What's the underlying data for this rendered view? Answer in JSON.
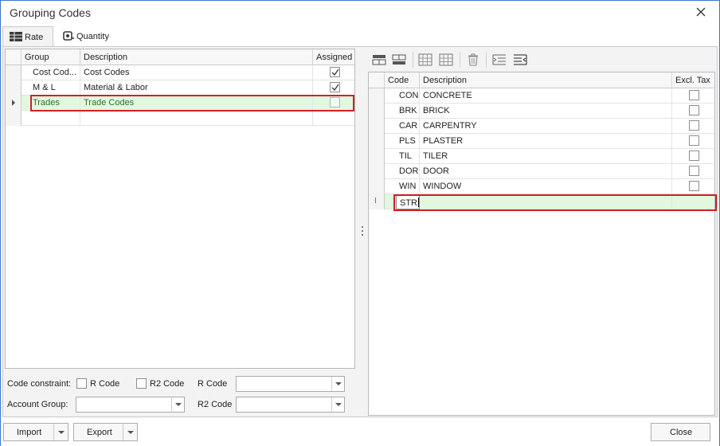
{
  "window": {
    "title": "Grouping Codes"
  },
  "tabs": [
    {
      "label": "Rate",
      "icon": "table-icon",
      "active": true
    },
    {
      "label": "Quantity",
      "icon": "tape-measure-icon",
      "active": false
    }
  ],
  "left_grid": {
    "headers": [
      "Group",
      "Description",
      "Assigned"
    ],
    "rows": [
      {
        "group": "Cost Cod...",
        "description": "Cost Codes",
        "assigned": true
      },
      {
        "group": "M & L",
        "description": "Material & Labor",
        "assigned": true
      },
      {
        "group": "Trades",
        "description": "Trade Codes",
        "assigned": false,
        "selected": true
      }
    ]
  },
  "toolbar": {
    "icons": [
      "insert-row-above-icon",
      "insert-row-below-icon",
      "grid-icon",
      "grid-alt-icon",
      "delete-icon",
      "outdent-icon",
      "indent-icon"
    ]
  },
  "right_grid": {
    "headers": [
      "Code",
      "Description",
      "Excl. Tax"
    ],
    "rows": [
      {
        "code": "CON",
        "description": "CONCRETE",
        "excl_tax": false
      },
      {
        "code": "BRK",
        "description": "BRICK",
        "excl_tax": false
      },
      {
        "code": "CAR",
        "description": "CARPENTRY",
        "excl_tax": false
      },
      {
        "code": "PLS",
        "description": "PLASTER",
        "excl_tax": false
      },
      {
        "code": "TIL",
        "description": "TILER",
        "excl_tax": false
      },
      {
        "code": "DOR",
        "description": "DOOR",
        "excl_tax": false
      },
      {
        "code": "WIN",
        "description": "WINDOW",
        "excl_tax": false
      }
    ],
    "editing_row": {
      "code": "STR",
      "description": ""
    }
  },
  "filters": {
    "code_constraint_label": "Code constraint:",
    "r_code_check_label": "R Code",
    "r2_code_check_label": "R2 Code",
    "r_code_label": "R Code",
    "r2_code_label": "R2 Code",
    "account_group_label": "Account Group:",
    "r_code_value": "",
    "r2_code_value": "",
    "account_group_value": ""
  },
  "buttons": {
    "import": "Import",
    "export": "Export",
    "close": "Close"
  },
  "colors": {
    "selected_row": "#e3f7df",
    "highlight_box": "#d11f26",
    "window_border": "#3c77c4"
  }
}
